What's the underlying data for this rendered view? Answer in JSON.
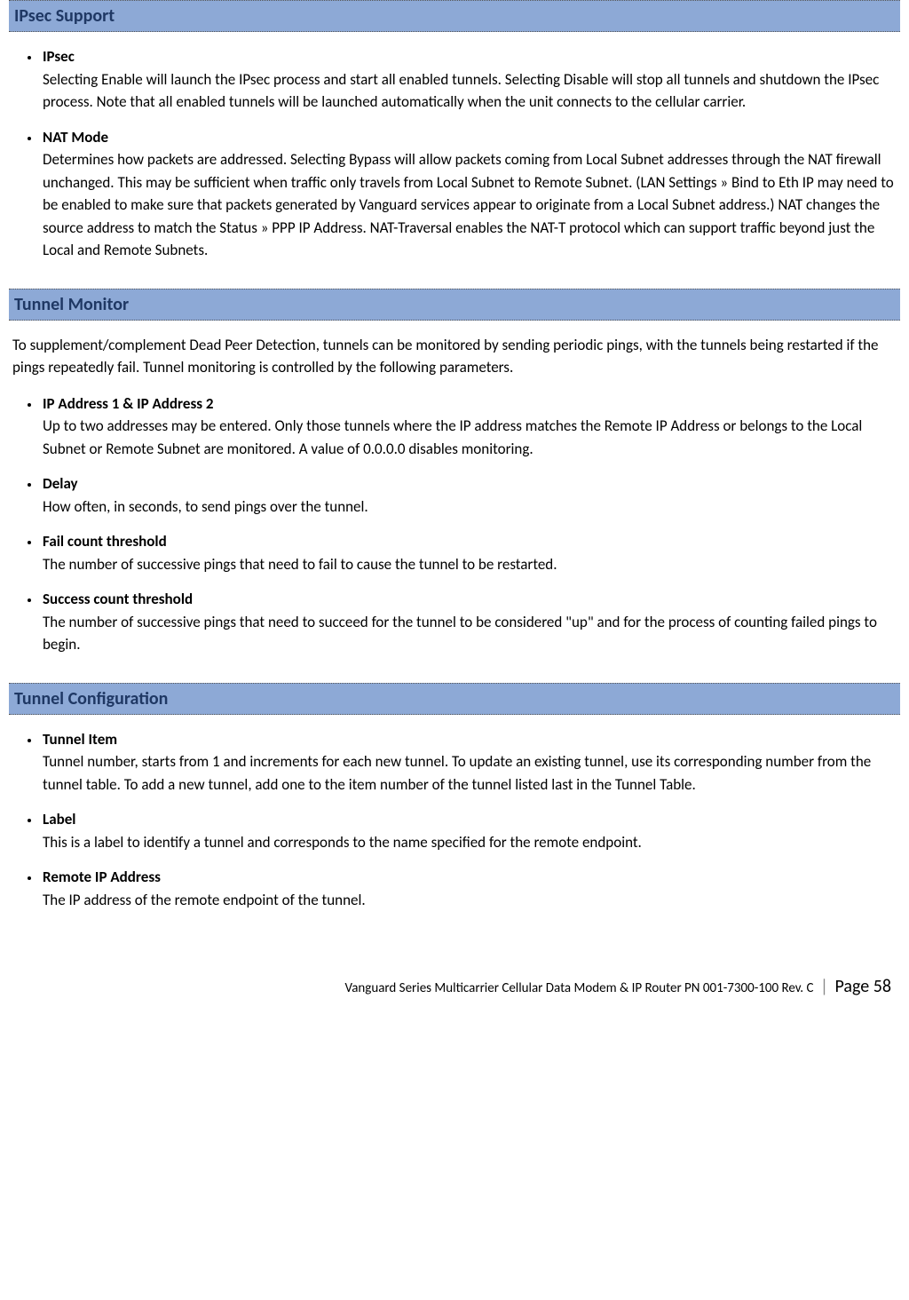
{
  "sections": [
    {
      "title": "IPsec Support",
      "intro": "",
      "items": [
        {
          "term": "IPsec",
          "desc": "Selecting Enable will launch the IPsec process and start all enabled tunnels. Selecting Disable will stop all tunnels and shutdown the IPsec process. Note that all enabled tunnels will be launched automatically when the unit connects to the cellular carrier."
        },
        {
          "term": "NAT Mode",
          "desc": "Determines how packets are addressed. Selecting Bypass will allow packets coming from Local Subnet addresses through the NAT firewall unchanged. This may be sufficient when traffic only travels from Local Subnet to Remote Subnet. (LAN Settings » Bind to Eth IP may need to be enabled to make sure that packets generated by Vanguard services appear to originate from a Local Subnet address.) NAT changes the source address to match the Status » PPP IP Address. NAT-Traversal enables the NAT-T protocol which can support traffic beyond just the Local and Remote Subnets."
        }
      ]
    },
    {
      "title": "Tunnel Monitor",
      "intro": "To supplement/complement Dead Peer Detection, tunnels can be monitored by sending periodic pings, with the tunnels being restarted if the pings repeatedly fail. Tunnel monitoring is controlled by the following parameters.",
      "items": [
        {
          "term": "IP Address 1 & IP Address 2",
          "desc": "Up to two addresses may be entered. Only those tunnels where the IP address matches the Remote IP Address or belongs to the Local Subnet or Remote Subnet are monitored. A value of 0.0.0.0 disables monitoring."
        },
        {
          "term": "Delay",
          "desc": "How often, in seconds, to send pings over the tunnel."
        },
        {
          "term": "Fail count threshold",
          "desc": "The number of successive pings that need to fail to cause the tunnel to be restarted."
        },
        {
          "term": "Success count threshold",
          "desc": "The number of successive pings that need to succeed for the tunnel to be considered \"up\" and for the process of counting failed pings to begin."
        }
      ]
    },
    {
      "title": "Tunnel Configuration",
      "intro": "",
      "items": [
        {
          "term": "Tunnel Item",
          "desc": "Tunnel number, starts from 1 and increments for each new tunnel. To update an existing tunnel, use its corresponding number from the tunnel table. To add a new tunnel, add one to the item number of the tunnel listed last in the Tunnel Table."
        },
        {
          "term": "Label",
          "desc": "This is a label to identify a tunnel and corresponds to the name specified for the remote endpoint."
        },
        {
          "term": "Remote IP Address",
          "desc": "The IP address of the remote endpoint of the tunnel."
        }
      ]
    }
  ],
  "footer": {
    "doc_title": "Vanguard Series Multicarrier Cellular Data Modem & IP Router PN 001-7300-100 Rev. C",
    "page_label": "Page 58"
  }
}
